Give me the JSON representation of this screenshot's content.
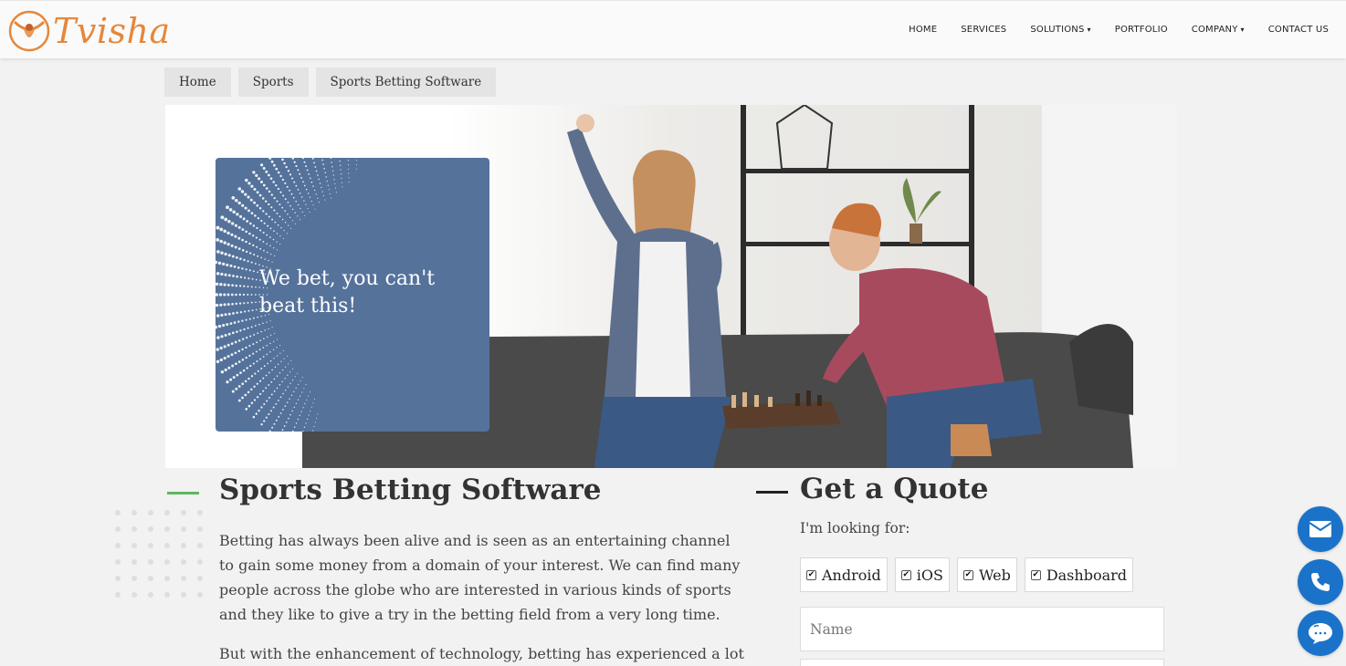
{
  "brand": {
    "name": "Tvisha",
    "color": "#e6873a"
  },
  "nav": {
    "items": [
      {
        "label": "HOME",
        "dropdown": false
      },
      {
        "label": "SERVICES",
        "dropdown": false
      },
      {
        "label": "SOLUTIONS",
        "dropdown": true
      },
      {
        "label": "PORTFOLIO",
        "dropdown": false
      },
      {
        "label": "COMPANY",
        "dropdown": true
      },
      {
        "label": "CONTACT US",
        "dropdown": false
      }
    ]
  },
  "breadcrumb": [
    "Home",
    "Sports",
    "Sports Betting Software"
  ],
  "hero": {
    "tagline": "We bet, you can't beat this!",
    "card_color": "#55729b"
  },
  "main": {
    "title": "Sports Betting Software",
    "paragraphs": [
      "Betting has always been alive and is seen as an entertaining channel to gain some money from a domain of your interest. We can find many people across the globe who are interested in various kinds of sports and they like to give a try in the betting field from a very long time.",
      "But with the enhancement of technology, betting has experienced a lot of"
    ],
    "accent_color": "#5cb85c"
  },
  "quote": {
    "title": "Get a Quote",
    "looking_for": "I'm looking for:",
    "options": [
      {
        "label": "Android",
        "checked": true
      },
      {
        "label": "iOS",
        "checked": true
      },
      {
        "label": "Web",
        "checked": true
      },
      {
        "label": "Dashboard",
        "checked": true
      }
    ],
    "name_placeholder": "Name"
  },
  "floating": {
    "color": "#1a73c8",
    "icons": [
      "envelope-icon",
      "phone-icon",
      "chat-icon"
    ]
  }
}
